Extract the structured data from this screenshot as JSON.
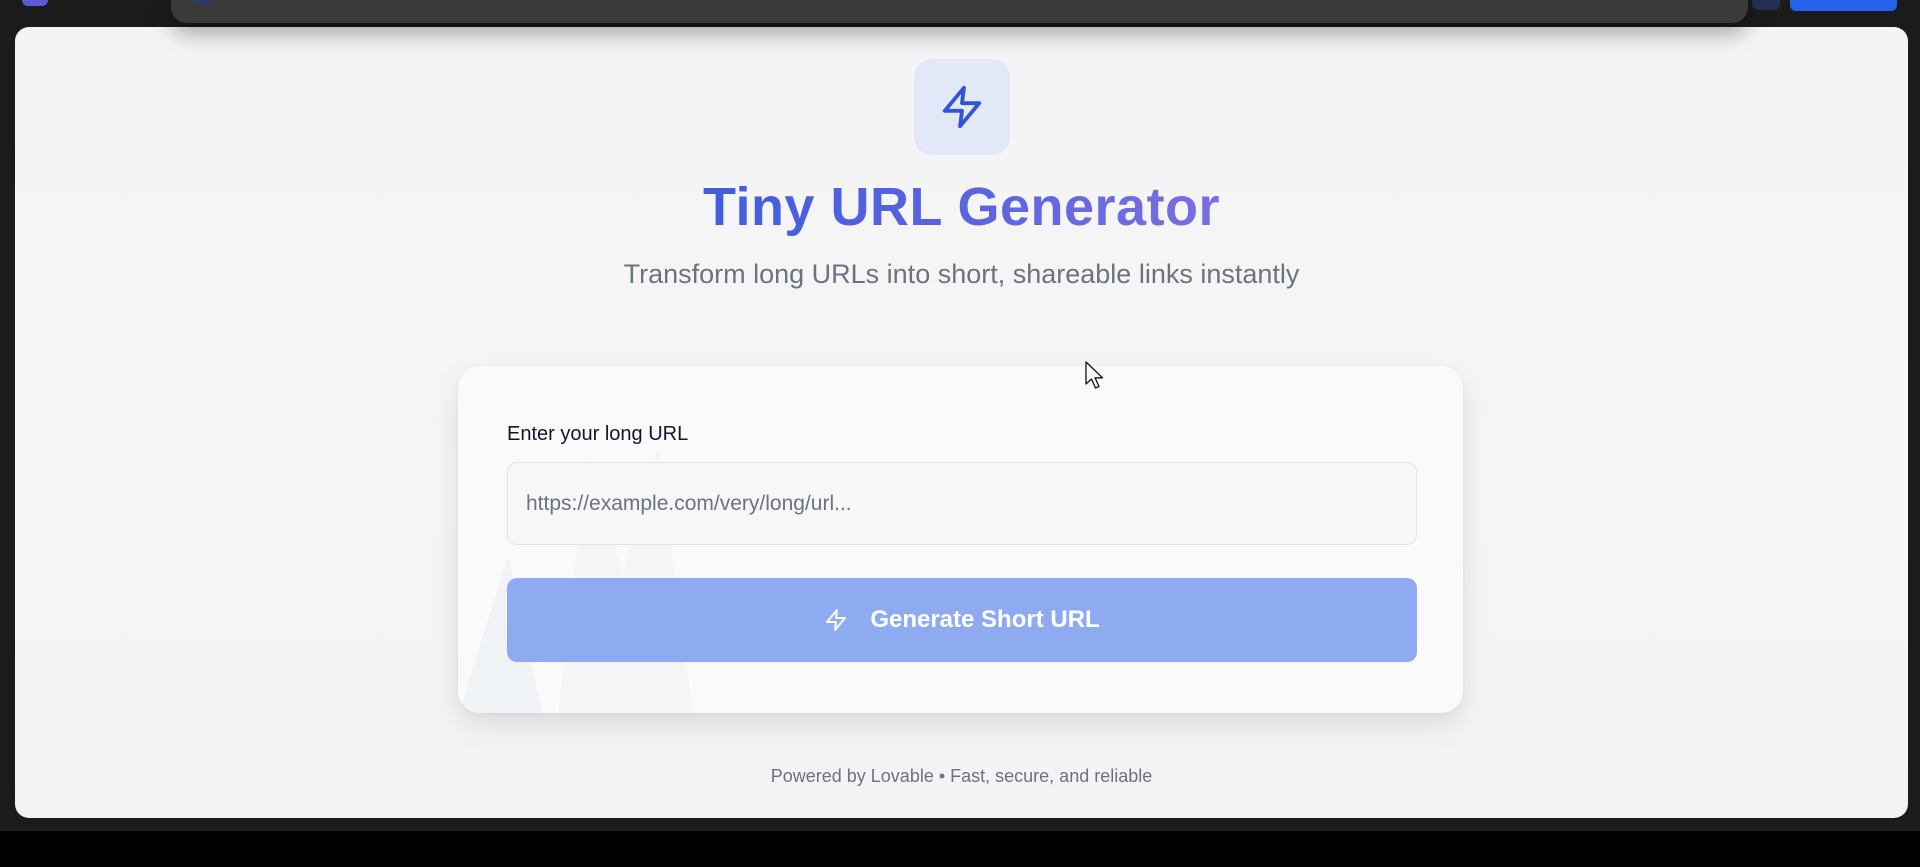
{
  "app": {
    "title": "Tiny URL Generator",
    "subtitle": "Transform long URLs into short, shareable links instantly",
    "logo_icon": "lightning-bolt-icon"
  },
  "form": {
    "label": "Enter your long URL",
    "url_input": {
      "value": "",
      "placeholder": "https://example.com/very/long/url..."
    },
    "generate_button": {
      "label": "Generate Short URL",
      "icon": "lightning-bolt-icon"
    }
  },
  "footer": {
    "text": "Powered by Lovable • Fast, secure, and reliable"
  },
  "colors": {
    "accent": "#3f5ee0",
    "button_disabled": "#8eabf2",
    "icon_tile": "#e3e8f8",
    "muted_text": "#6b7280"
  }
}
